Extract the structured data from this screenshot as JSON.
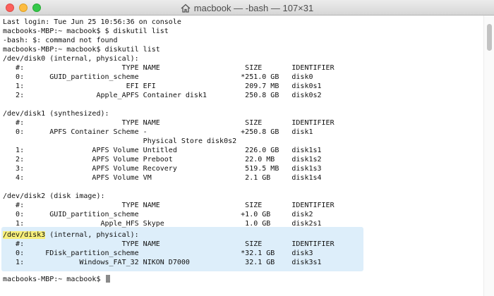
{
  "window": {
    "title": "macbook — -bash — 107×31"
  },
  "terminal": {
    "lines": [
      "Last login: Tue Jun 25 10:56:36 on console",
      "macbooks-MBP:~ macbook$ $ diskutil list",
      "-bash: $: command not found",
      "macbooks-MBP:~ macbook$ diskutil list",
      "/dev/disk0 (internal, physical):",
      "   #:                       TYPE NAME                    SIZE       IDENTIFIER",
      "   0:      GUID_partition_scheme                        *251.0 GB   disk0",
      "   1:                        EFI EFI                     209.7 MB   disk0s1",
      "   2:                 Apple_APFS Container disk1         250.8 GB   disk0s2",
      "",
      "/dev/disk1 (synthesized):",
      "   #:                       TYPE NAME                    SIZE       IDENTIFIER",
      "   0:      APFS Container Scheme -                      +250.8 GB   disk1",
      "                                 Physical Store disk0s2",
      "   1:                APFS Volume Untitled                226.0 GB   disk1s1",
      "   2:                APFS Volume Preboot                 22.0 MB    disk1s2",
      "   3:                APFS Volume Recovery                519.5 MB   disk1s3",
      "   4:                APFS Volume VM                      2.1 GB     disk1s4",
      "",
      "/dev/disk2 (disk image):",
      "   #:                       TYPE NAME                    SIZE       IDENTIFIER",
      "   0:      GUID_partition_scheme                        +1.0 GB     disk2",
      "   1:                  Apple_HFS Skype                   1.0 GB     disk2s1",
      "",
      "",
      "   #:                       TYPE NAME                    SIZE       IDENTIFIER",
      "   0:     FDisk_partition_scheme                        *32.1 GB    disk3",
      "   1:             Windows_FAT_32 NIKON D7000             32.1 GB    disk3s1",
      "",
      "macbooks-MBP:~ macbook$ "
    ],
    "disk3_selected": "/dev/disk3",
    "disk3_rest": " (internal, physical):"
  }
}
